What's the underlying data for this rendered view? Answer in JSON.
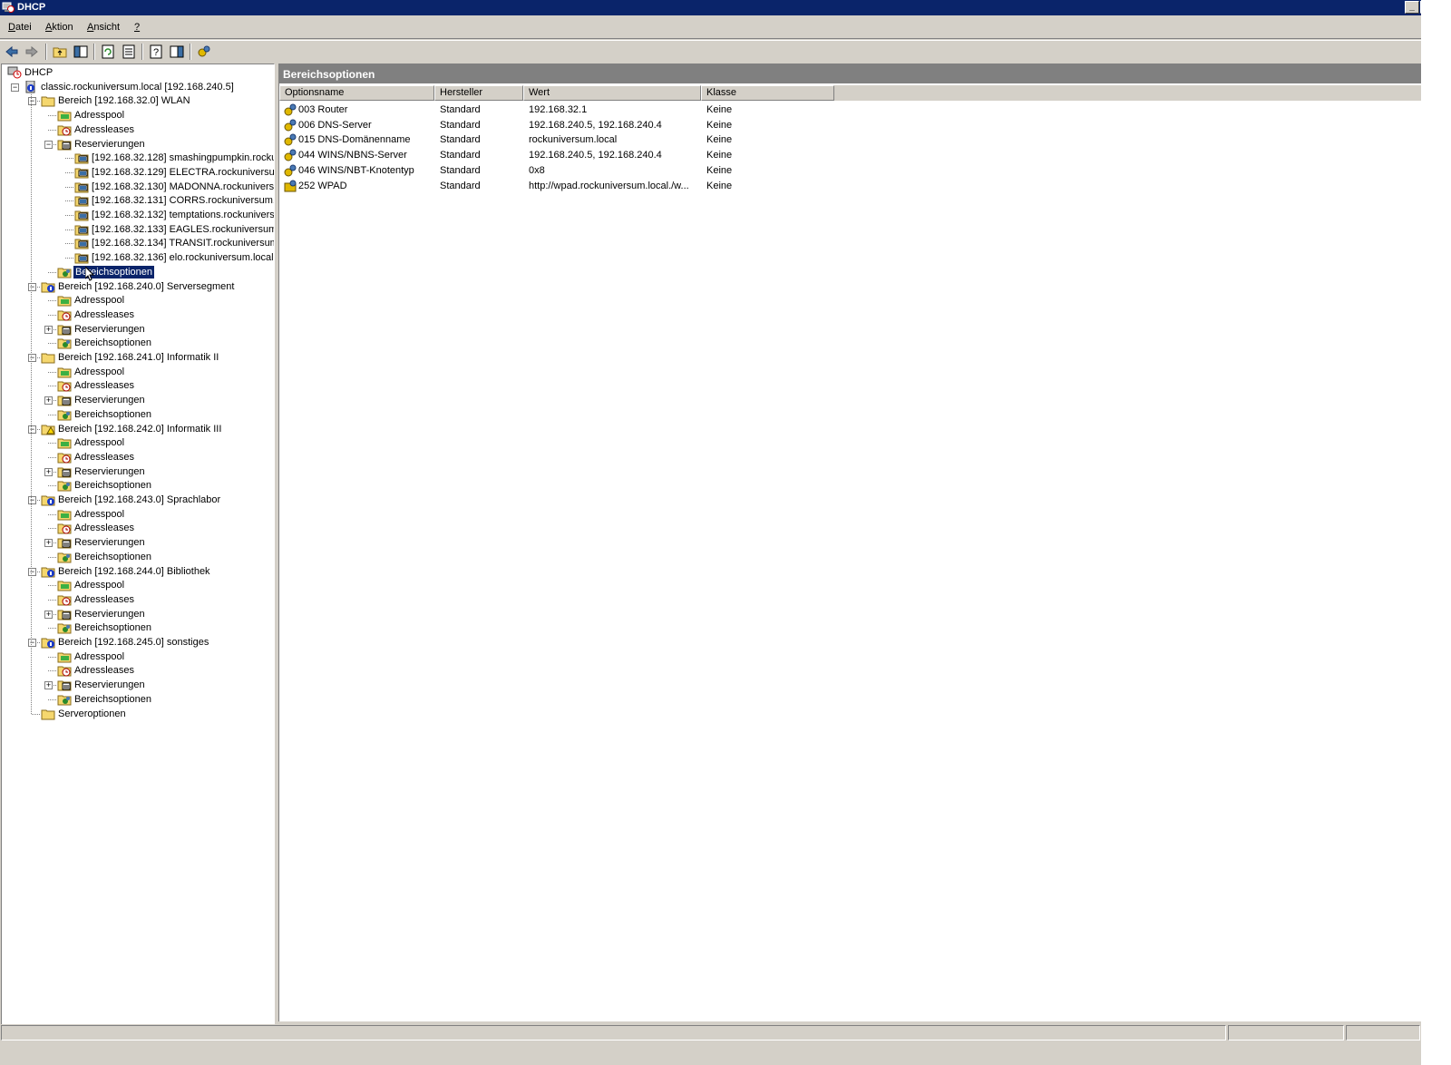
{
  "window": {
    "title": "DHCP",
    "controls": [
      "minimize",
      "restore",
      "close"
    ]
  },
  "menu": [
    {
      "label": "Datei",
      "underline": "D",
      "rest": "atei"
    },
    {
      "label": "Aktion",
      "underline": "A",
      "rest": "ktion"
    },
    {
      "label": "Ansicht",
      "underline": "A",
      "rest": "nsicht"
    },
    {
      "label": "?",
      "underline": "?",
      "rest": ""
    }
  ],
  "toolbar": {
    "icons": [
      "back-icon",
      "forward-icon",
      "up-folder-icon",
      "show-hide-tree-icon",
      "refresh-icon",
      "export-list-icon",
      "help-icon",
      "properties-icon",
      "options-icon"
    ]
  },
  "tree": {
    "root": "DHCP",
    "server": "classic.rockuniversum.local [192.168.240.5]",
    "scope_wlan": "Bereich [192.168.32.0] WLAN",
    "adresspool": "Adresspool",
    "adressleases": "Adressleases",
    "reservierungen": "Reservierungen",
    "bereichsoptionen": "Bereichsoptionen",
    "reservations": [
      "[192.168.32.128] smashingpumpkin.rockur",
      "[192.168.32.129] ELECTRA.rockuniversum",
      "[192.168.32.130] MADONNA.rockuniversu",
      "[192.168.32.131] CORRS.rockuniversum.lo",
      "[192.168.32.132] temptations.rockunivers",
      "[192.168.32.133] EAGLES.rockuniversum.l",
      "[192.168.32.134] TRANSIT.rockuniversum",
      "[192.168.32.136] elo.rockuniversum.local"
    ],
    "scopes": [
      "Bereich [192.168.240.0] Serversegment",
      "Bereich [192.168.241.0] Informatik II",
      "Bereich [192.168.242.0] Informatik III",
      "Bereich [192.168.243.0] Sprachlabor",
      "Bereich [192.168.244.0] Bibliothek",
      "Bereich [192.168.245.0] sonstiges"
    ],
    "serveroptionen": "Serveroptionen",
    "selected": "Bereichsoptionen"
  },
  "details": {
    "header": "Bereichsoptionen",
    "columns": [
      "Optionsname",
      "Hersteller",
      "Wert",
      "Klasse"
    ],
    "rows": [
      {
        "name": "003 Router",
        "vendor": "Standard",
        "value": "192.168.32.1",
        "class": "Keine"
      },
      {
        "name": "006 DNS-Server",
        "vendor": "Standard",
        "value": "192.168.240.5, 192.168.240.4",
        "class": "Keine"
      },
      {
        "name": "015 DNS-Domänenname",
        "vendor": "Standard",
        "value": "rockuniversum.local",
        "class": "Keine"
      },
      {
        "name": "044 WINS/NBNS-Server",
        "vendor": "Standard",
        "value": "192.168.240.5, 192.168.240.4",
        "class": "Keine"
      },
      {
        "name": "046 WINS/NBT-Knotentyp",
        "vendor": "Standard",
        "value": "0x8",
        "class": "Keine"
      },
      {
        "name": "252 WPAD",
        "vendor": "Standard",
        "value": "http://wpad.rockuniversum.local./w...",
        "class": "Keine"
      }
    ]
  },
  "colors": {
    "title_bg": "#0a246a",
    "selection": "#0a246a",
    "chrome": "#d4d0c8",
    "header_bg": "#808080"
  }
}
